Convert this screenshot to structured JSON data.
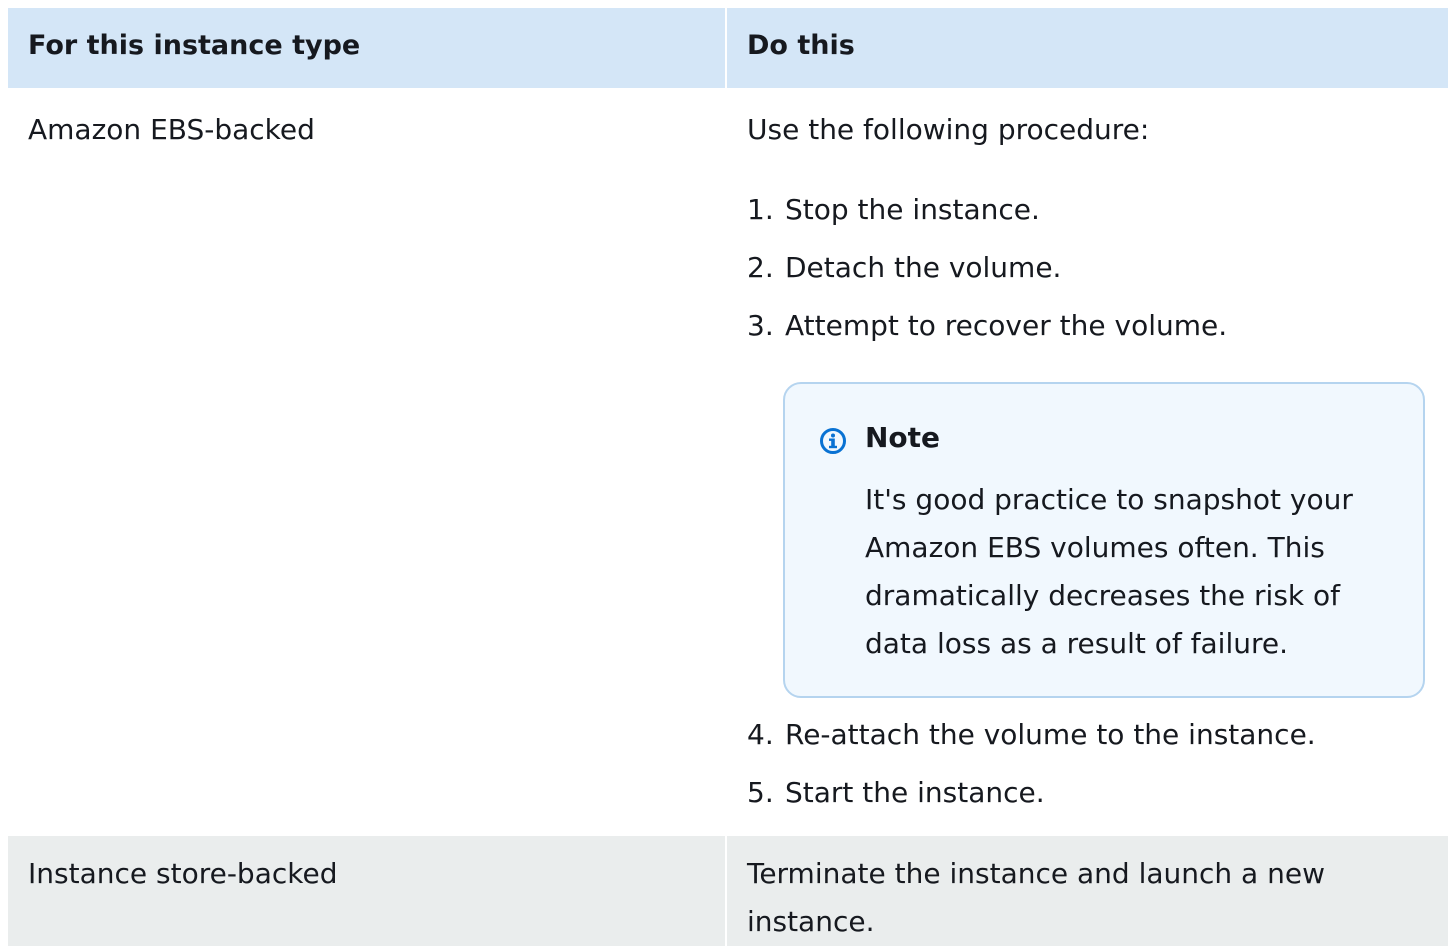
{
  "table": {
    "headers": [
      "For this instance type",
      "Do this"
    ],
    "rows": [
      {
        "instance_type": "Amazon EBS-backed",
        "intro": "Use the following procedure:",
        "steps": [
          {
            "num": "1.",
            "text": "Stop the instance."
          },
          {
            "num": "2.",
            "text": "Detach the volume."
          },
          {
            "num": "3.",
            "text": "Attempt to recover the volume."
          },
          {
            "num": "4.",
            "text": "Re-attach the volume to the instance."
          },
          {
            "num": "5.",
            "text": "Start the instance."
          }
        ],
        "note": {
          "title": "Note",
          "text": "It's good practice to snapshot your Amazon EBS volumes often. This dramatically decreases the risk of data loss as a result of failure.",
          "icon": "info-icon"
        }
      },
      {
        "instance_type": "Instance store-backed",
        "action": "Terminate the instance and launch a new instance."
      }
    ]
  },
  "colors": {
    "header_bg": "#d4e6f7",
    "row_alt_bg": "#eaeded",
    "note_bg": "#f1f8fe",
    "note_border": "#b5d4ef",
    "info_icon": "#0972d3"
  }
}
